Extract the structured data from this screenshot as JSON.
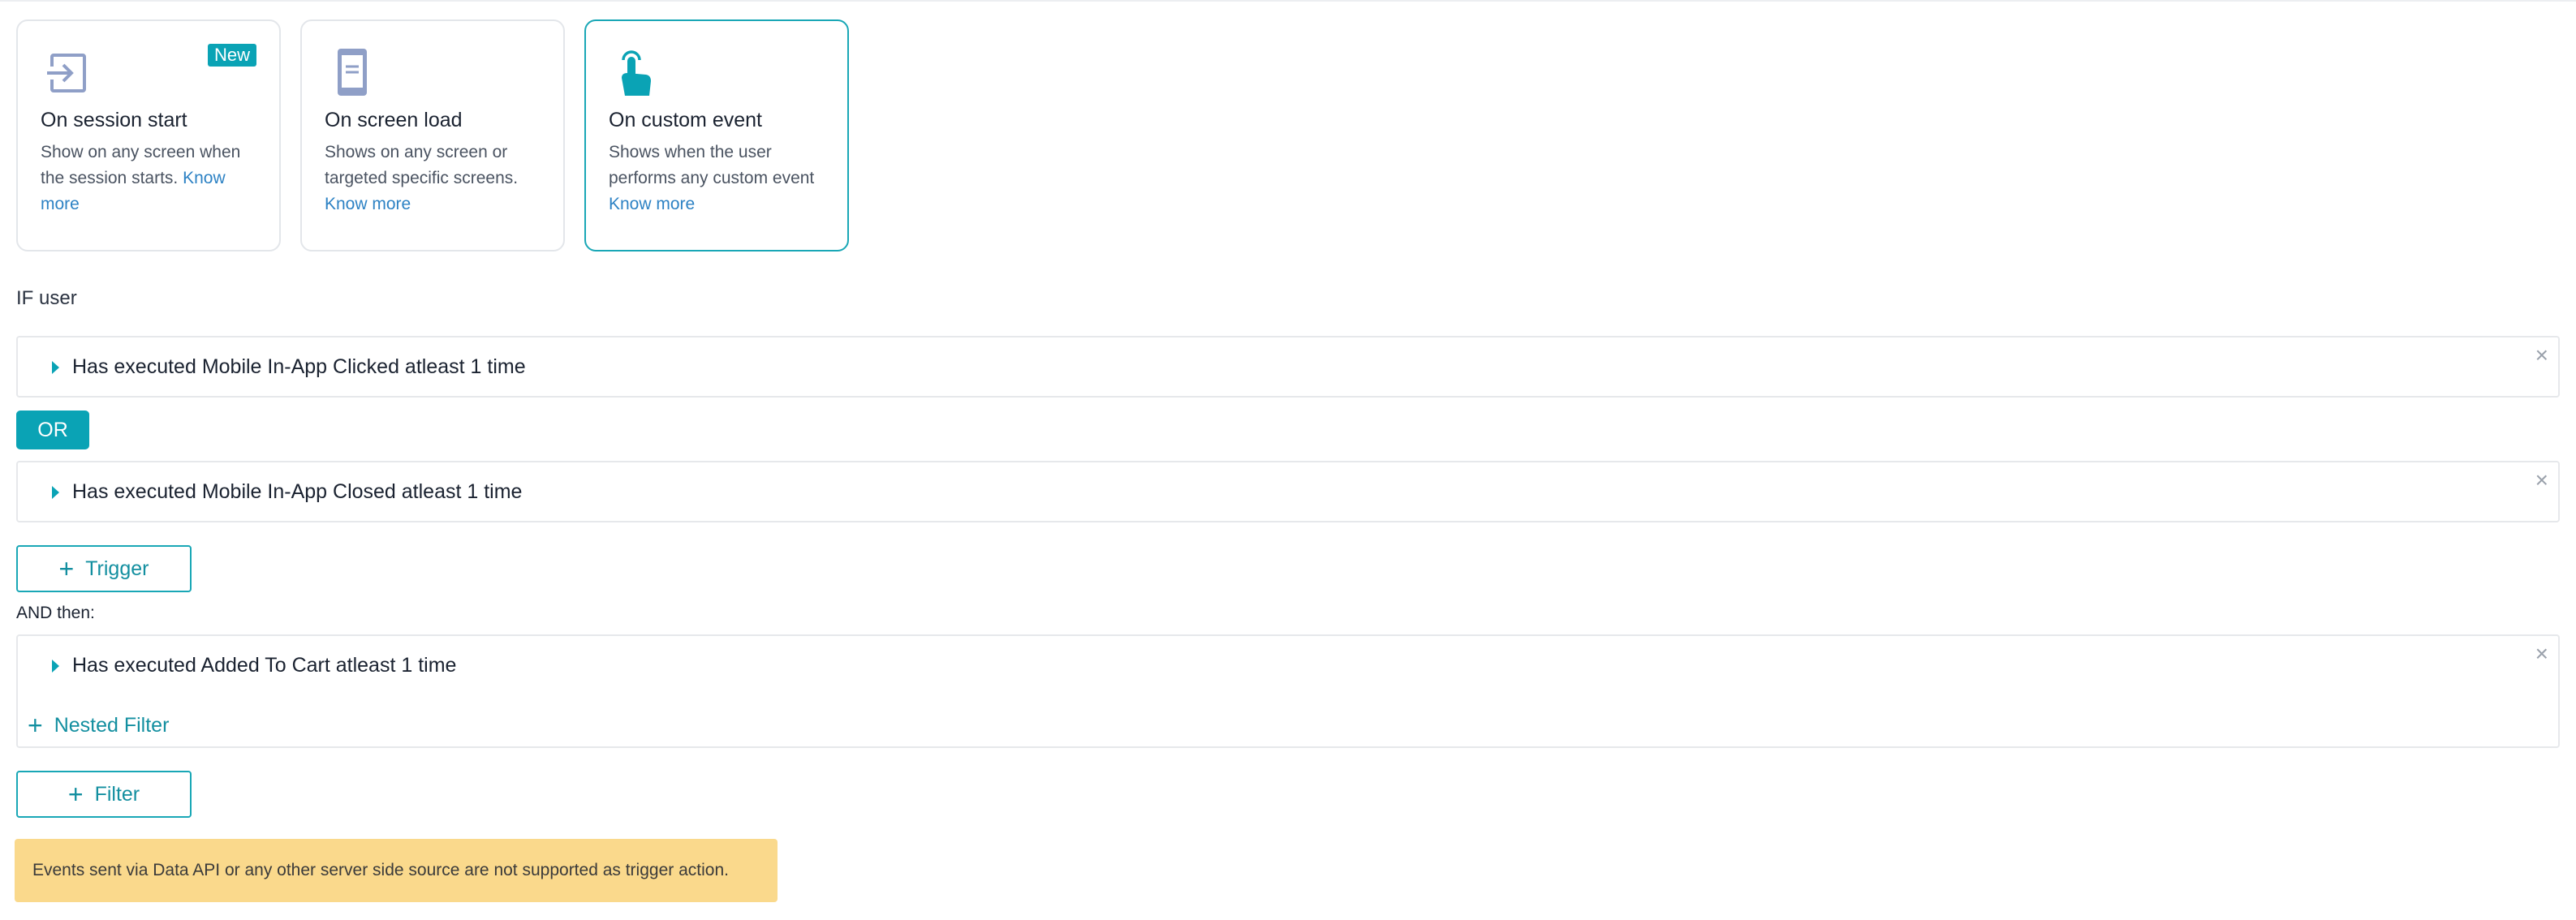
{
  "cards": [
    {
      "icon": "enter-arrow-icon",
      "title": "On session start",
      "desc": "Show on any screen when the session starts.",
      "link": "Know more",
      "badge": "New",
      "selected": false
    },
    {
      "icon": "mobile-screen-icon",
      "title": "On screen load",
      "desc": "Shows on any screen or targeted specific screens.",
      "link": "Know more",
      "selected": false
    },
    {
      "icon": "tap-finger-icon",
      "title": "On custom event",
      "desc": "Shows when the user performs any custom event",
      "link": "Know more",
      "selected": true
    }
  ],
  "if_label": "IF user",
  "triggers": [
    {
      "text": "Has executed Mobile In-App Clicked atleast 1 time"
    },
    {
      "text": "Has executed Mobile In-App Closed atleast 1 time"
    }
  ],
  "or_label": "OR",
  "trigger_button": "Trigger",
  "and_label": "AND then:",
  "filter": {
    "text": "Has executed Added To Cart atleast 1 time",
    "nested_label": "Nested Filter"
  },
  "filter_button": "Filter",
  "notice": "Events sent via Data API or any other server side source are not supported as trigger action.",
  "colors": {
    "accent": "#0aa3b5",
    "link": "#2d82c4",
    "notice_bg": "#fad98c",
    "icon_muted": "#8f9fc7"
  }
}
